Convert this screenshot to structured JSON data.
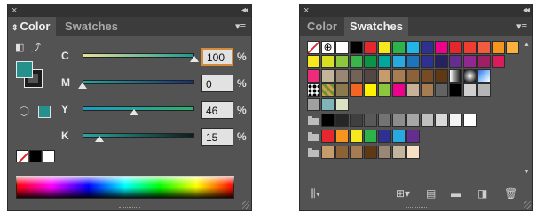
{
  "color_panel": {
    "close": "×",
    "collapse": "◂◂",
    "tabs": [
      {
        "label": "Color",
        "active": true
      },
      {
        "label": "Swatches",
        "active": false
      }
    ],
    "menu": "▾≡",
    "fill_color": "#26908c",
    "sliders": [
      {
        "label": "C",
        "value": "100",
        "fraction": 1.0,
        "gradient_from": "#e6e09a",
        "gradient_to": "#1a9a94",
        "focused": true
      },
      {
        "label": "M",
        "value": "0",
        "fraction": 0.0,
        "gradient_from": "#1fa89f",
        "gradient_to": "#1a2f7a",
        "focused": false
      },
      {
        "label": "Y",
        "value": "46",
        "fraction": 0.46,
        "gradient_from": "#1a9bc8",
        "gradient_to": "#2cb36a",
        "focused": false
      },
      {
        "label": "K",
        "value": "15",
        "fraction": 0.15,
        "gradient_from": "#2aa6a0",
        "gradient_to": "#0e1c1c",
        "focused": false
      }
    ],
    "percent": "%"
  },
  "swatches_panel": {
    "close": "×",
    "collapse": "◂◂",
    "tabs": [
      {
        "label": "Color",
        "active": false
      },
      {
        "label": "Swatches",
        "active": true
      }
    ],
    "menu": "▾≡",
    "rows": [
      [
        "none",
        "registration",
        "#ffffff",
        "#000000",
        "#e6272d",
        "#f5e81e",
        "#2cb34a",
        "#22b5e8",
        "#2e3192",
        "#ec008c",
        "#e5272d",
        "#ee3e33",
        "#f15b40",
        "#f7941d",
        "#fcb040"
      ],
      [
        "#f6e81e",
        "#d7df23",
        "#8dc63f",
        "#39b54a",
        "#0b9444",
        "#00a79d",
        "#28aae1",
        "#1c75bc",
        "#2e3192",
        "#262262",
        "#662d91",
        "#92278f",
        "#9e1f63",
        "#da1c5c"
      ],
      [
        "#ee2a7b",
        "#c2b59b",
        "#998675",
        "#736357",
        "#534741",
        "#c69c6d",
        "#a67c52",
        "#8c6239",
        "#754c24",
        "#603813",
        "#grad-black",
        "#grad-radial",
        "#grad-rainbow"
      ],
      [
        "pattern-dots",
        "pattern-leaves",
        "#8b7a4e",
        "#f26522",
        "#fff200",
        "#8cc63f",
        "#ec008c",
        "#c7b299",
        "#a67c52",
        "#636363",
        "#000000",
        "#d0d0d0",
        "#b5b5b5"
      ],
      [
        "#a0a0a0",
        "#7fb4b9",
        "#d9e3c4"
      ],
      [
        "folder",
        "#000000",
        "#262626",
        "#404040",
        "#595959",
        "#737373",
        "#8c8c8c",
        "#a6a6a6",
        "#bfbfbf",
        "#d9d9d9",
        "#f2f2f2",
        "#ffffff"
      ],
      [
        "folder",
        "#e6272d",
        "#f7941d",
        "#f5e81e",
        "#2cb34a",
        "#2e3192",
        "#28aae1",
        "#662d91"
      ],
      [
        "folder",
        "#c69c6d",
        "#8c6239",
        "#a67c52",
        "#603813",
        "#998675",
        "#c2b59b",
        "#f5e0c3"
      ]
    ],
    "footer_icons": [
      "library-icon",
      "show-kinds-icon",
      "swatch-options-icon",
      "new-group-icon",
      "new-swatch-icon",
      "delete-icon"
    ]
  }
}
